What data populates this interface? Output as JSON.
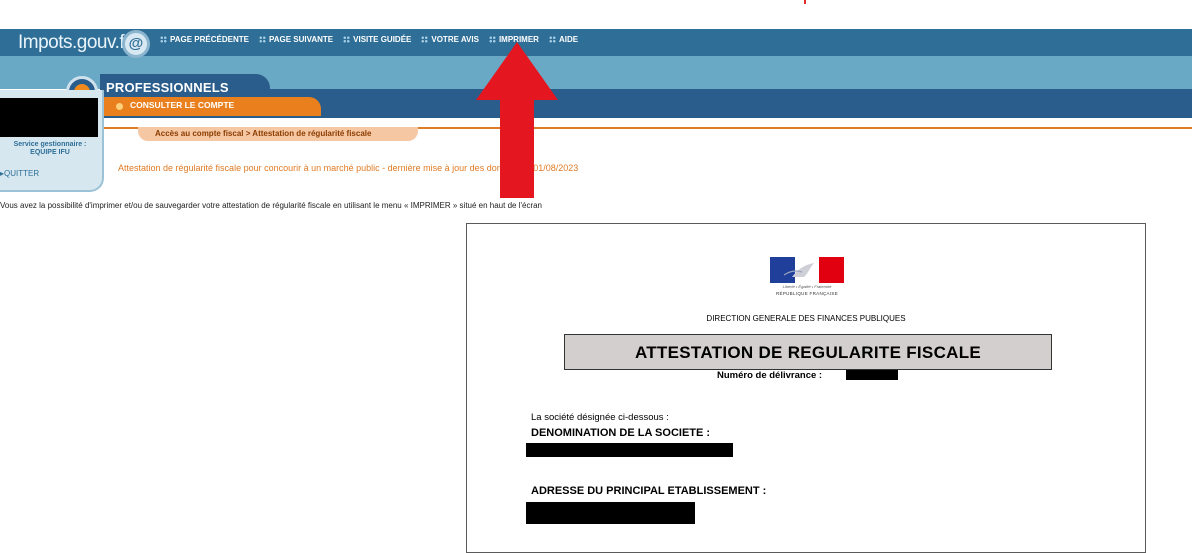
{
  "header": {
    "site_logo": "Impots.gouv.fr",
    "emblem_letter": "@"
  },
  "top_menu": [
    {
      "id": "previous",
      "label": "PAGE PRÉCÉDENTE"
    },
    {
      "id": "next",
      "label": "PAGE SUIVANTE"
    },
    {
      "id": "tour",
      "label": "VISITE GUIDÉE"
    },
    {
      "id": "feedback",
      "label": "VOTRE AVIS"
    },
    {
      "id": "print",
      "label": "IMPRIMER"
    },
    {
      "id": "help",
      "label": "AIDE"
    }
  ],
  "section": {
    "title": "PROFESSIONNELS",
    "tab_label": "CONSULTER LE COMPTE"
  },
  "sidebar": {
    "service_label": "Service gestionnaire :",
    "service_name": "EQUIPE IFU",
    "quit_label": "QUITTER"
  },
  "breadcrumb": "Accès au compte fiscal > Attestation de régularité fiscale",
  "info_line": "Attestation de régularité fiscale pour concourir à un marché public - dernière mise à jour des données le 01/08/2023",
  "help_line": "Vous avez la possibilité d'imprimer et/ou de sauvegarder votre attestation de régularité fiscale en utilisant le menu « IMPRIMER » situé en haut de l'écran",
  "document": {
    "motto": "Liberté • Égalité • Fraternité",
    "republic": "RÉPUBLIQUE FRANÇAISE",
    "directorate": "DIRECTION GENERALE DES FINANCES PUBLIQUES",
    "title": "ATTESTATION DE REGULARITE FISCALE",
    "delivery_label": "Numéro de délivrance :",
    "society_intro": "La société désignée ci-dessous :",
    "denomination_label": "DENOMINATION DE LA SOCIETE :",
    "address_label": "ADRESSE DU PRINCIPAL ETABLISSEMENT :"
  },
  "colors": {
    "header_blue": "#2f6f97",
    "header_light": "#6aa9c6",
    "section_dark": "#2b5d8c",
    "accent_orange": "#e9801d",
    "arrow_red": "#e4161f"
  }
}
